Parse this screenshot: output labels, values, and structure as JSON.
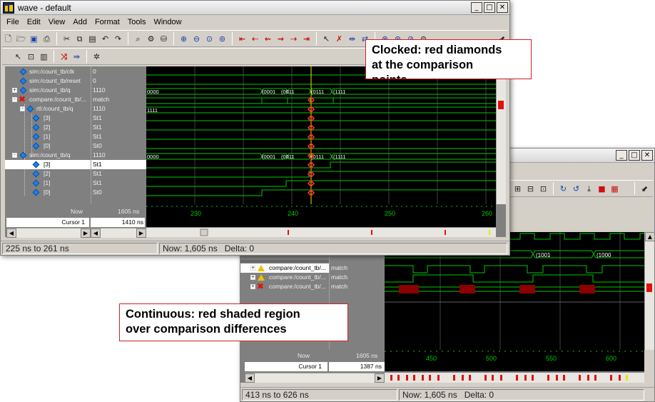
{
  "window1": {
    "title": "wave - default",
    "menu": [
      "File",
      "Edit",
      "View",
      "Add",
      "Format",
      "Tools",
      "Window"
    ],
    "signals": [
      {
        "name": "sim:/count_tb/clk",
        "value": "0"
      },
      {
        "name": "sim:/count_tb/reset",
        "value": "0"
      },
      {
        "name": "sim:/count_tb/q",
        "value": "1110"
      },
      {
        "name": "compare:/count_tb/...",
        "value": "match"
      },
      {
        "name": "rtl:/count_tb/q",
        "value": "1110"
      },
      {
        "name": "[3]",
        "value": "St1"
      },
      {
        "name": "[2]",
        "value": "St1"
      },
      {
        "name": "[1]",
        "value": "St1"
      },
      {
        "name": "[0]",
        "value": "St0"
      },
      {
        "name": "sim:/count_tb/q",
        "value": "1110"
      },
      {
        "name": "[3]",
        "value": "St1"
      },
      {
        "name": "[2]",
        "value": "St1"
      },
      {
        "name": "[1]",
        "value": "St1"
      },
      {
        "name": "[0]",
        "value": "St0"
      }
    ],
    "bus_labels": {
      "row2": [
        "0000",
        "(0001",
        "(0011",
        "(0111",
        "(1111"
      ],
      "row4": [
        "1111"
      ],
      "row9": [
        "0000",
        "(0001",
        "(0011",
        "(0111",
        "(1111"
      ]
    },
    "now_label": "Now",
    "now_value": "1605 ns",
    "cursor_label": "Cursor 1",
    "cursor_value": "1410 ns",
    "time_ticks": [
      "230",
      "240",
      "250",
      "260"
    ],
    "status_range": "225 ns to 261 ns",
    "status_now": "Now: 1,605 ns",
    "status_delta": "Delta: 0"
  },
  "window2": {
    "signals": [
      {
        "name": "compare:/count_tb/...",
        "value": "match",
        "icon": "warning-icon"
      },
      {
        "name": "compare:/count_tb/...",
        "value": "match",
        "icon": "warning-icon"
      },
      {
        "name": "compare:/count_tb/...",
        "value": "match",
        "icon": "error-x-icon"
      }
    ],
    "bus_labels": [
      "(1001",
      "(1000"
    ],
    "now_label": "Now",
    "now_value": "1605 ns",
    "cursor_label": "Cursor 1",
    "cursor_value": "1387 ns",
    "time_ticks": [
      "450",
      "500",
      "550",
      "600"
    ],
    "status_range": "413 ns to 626 ns",
    "status_now": "Now: 1,605 ns",
    "status_delta": "Delta: 0"
  },
  "callouts": {
    "clocked": "Clocked: red diamonds\nat the comparison\npoints",
    "continuous": "Continuous: red shaded region\nover comparison differences"
  },
  "colors": {
    "trace": "#00c800",
    "bus_text": "#ffffff",
    "diff_marker": "#e01010",
    "diff_region": "#8b0000",
    "cursor": "#e8e800",
    "callout_border": "#d02020"
  }
}
